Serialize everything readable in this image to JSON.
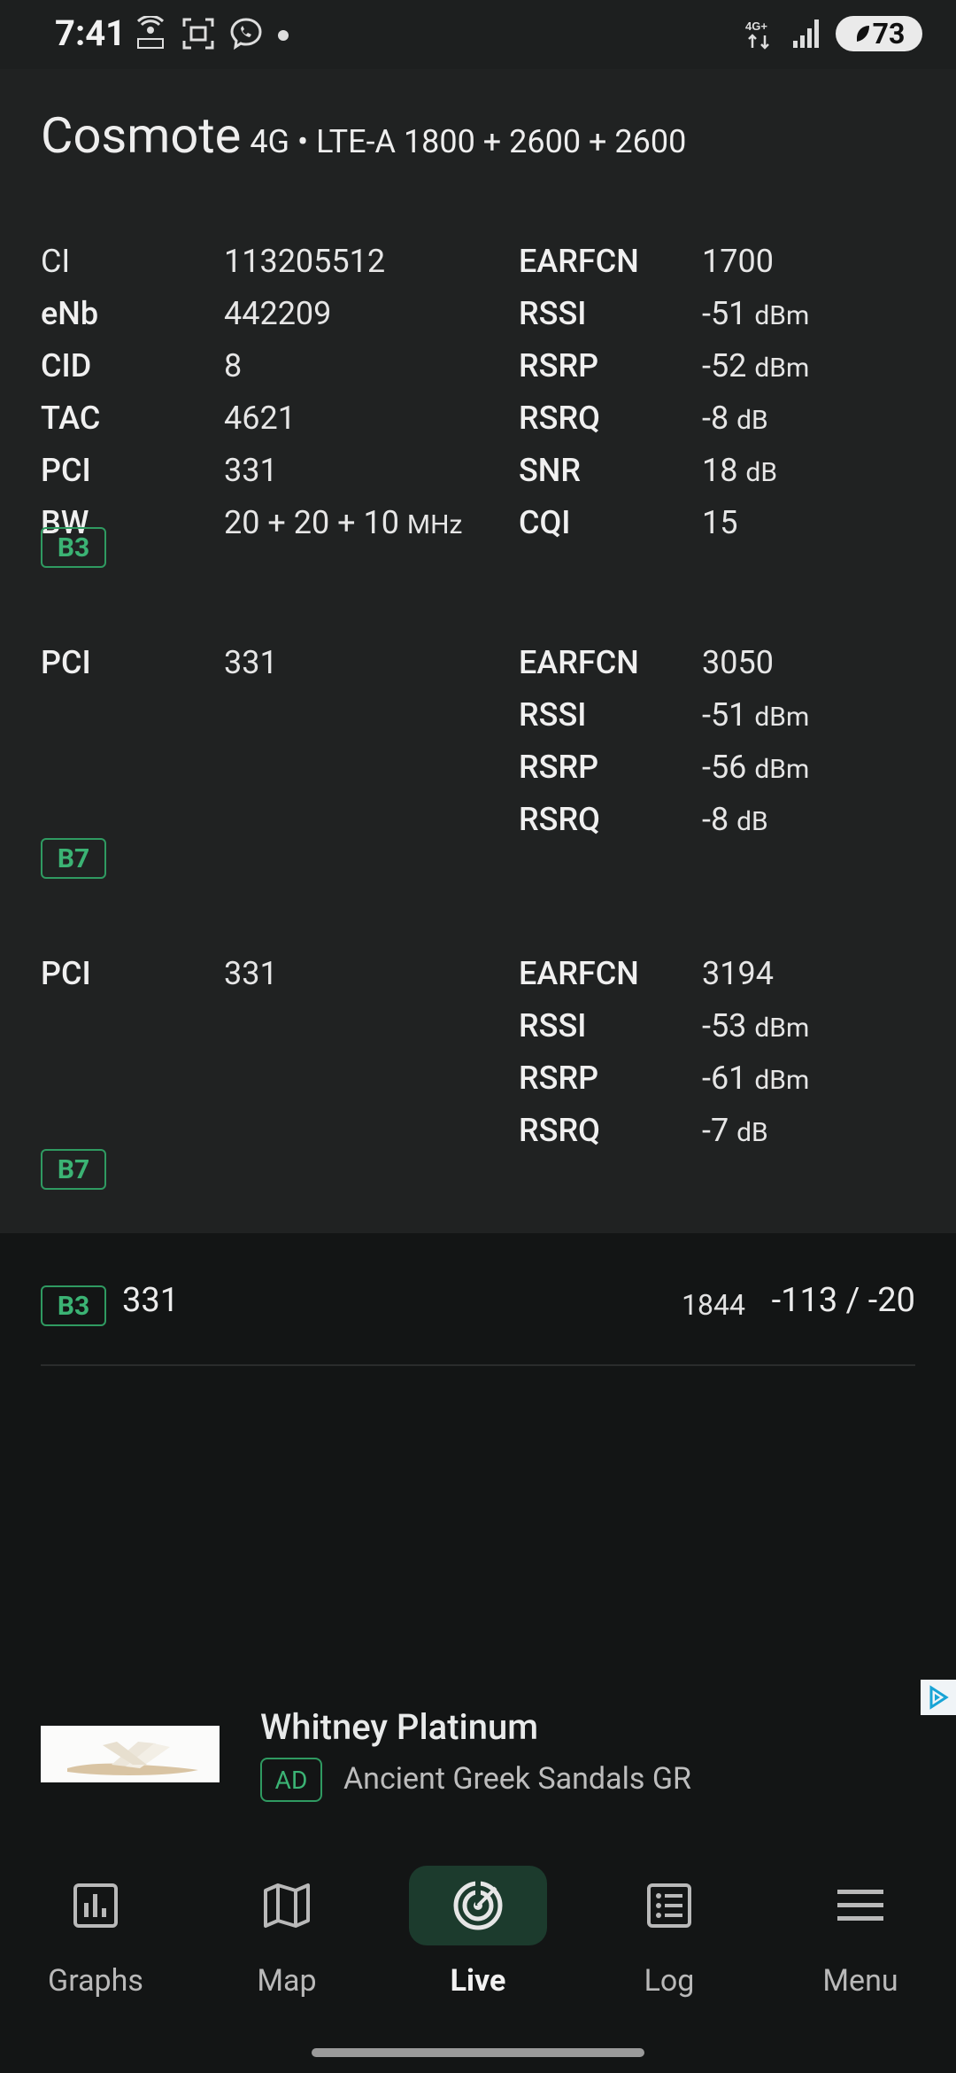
{
  "status_bar": {
    "time": "7:41",
    "network": "4G+",
    "battery": "73"
  },
  "operator": {
    "name": "Cosmote",
    "technology": "4G • LTE-A 1800 + 2600 + 2600"
  },
  "primary_cell": {
    "left": [
      {
        "label": "CI",
        "value": "113205512",
        "unit": ""
      },
      {
        "label": "eNb",
        "value": "442209",
        "unit": ""
      },
      {
        "label": "CID",
        "value": "8",
        "unit": ""
      },
      {
        "label": "TAC",
        "value": "4621",
        "unit": ""
      },
      {
        "label": "PCI",
        "value": "331",
        "unit": ""
      },
      {
        "label": "BW",
        "value": "20 + 20 + 10",
        "unit": "MHz"
      }
    ],
    "right": [
      {
        "label": "EARFCN",
        "value": "1700",
        "unit": ""
      },
      {
        "label": "RSSI",
        "value": "-51",
        "unit": "dBm"
      },
      {
        "label": "RSRP",
        "value": "-52",
        "unit": "dBm"
      },
      {
        "label": "RSRQ",
        "value": "-8",
        "unit": "dB"
      },
      {
        "label": "SNR",
        "value": "18",
        "unit": "dB"
      },
      {
        "label": "CQI",
        "value": "15",
        "unit": ""
      }
    ],
    "band": "B3"
  },
  "secondary_cells": [
    {
      "left": {
        "label": "PCI",
        "value": "331"
      },
      "right": [
        {
          "label": "EARFCN",
          "value": "3050",
          "unit": ""
        },
        {
          "label": "RSSI",
          "value": "-51",
          "unit": "dBm"
        },
        {
          "label": "RSRP",
          "value": "-56",
          "unit": "dBm"
        },
        {
          "label": "RSRQ",
          "value": "-8",
          "unit": "dB"
        }
      ],
      "band": "B7"
    },
    {
      "left": {
        "label": "PCI",
        "value": "331"
      },
      "right": [
        {
          "label": "EARFCN",
          "value": "3194",
          "unit": ""
        },
        {
          "label": "RSSI",
          "value": "-53",
          "unit": "dBm"
        },
        {
          "label": "RSRP",
          "value": "-61",
          "unit": "dBm"
        },
        {
          "label": "RSRQ",
          "value": "-7",
          "unit": "dB"
        }
      ],
      "band": "B7"
    }
  ],
  "neighbor": {
    "band": "B3",
    "pci": "331",
    "earfcn": "1844",
    "signal": "-113 / -20"
  },
  "ad": {
    "title": "Whitney Platinum",
    "badge": "AD",
    "advertiser": "Ancient Greek Sandals GR"
  },
  "nav": {
    "items": [
      {
        "label": "Graphs",
        "icon": "graphs-icon"
      },
      {
        "label": "Map",
        "icon": "map-icon"
      },
      {
        "label": "Live",
        "icon": "live-radar-icon"
      },
      {
        "label": "Log",
        "icon": "log-icon"
      },
      {
        "label": "Menu",
        "icon": "menu-icon"
      }
    ],
    "active": "Live"
  },
  "colors": {
    "accent_green": "#3bb374",
    "panel_bg": "#202222",
    "app_bg": "#131515"
  }
}
